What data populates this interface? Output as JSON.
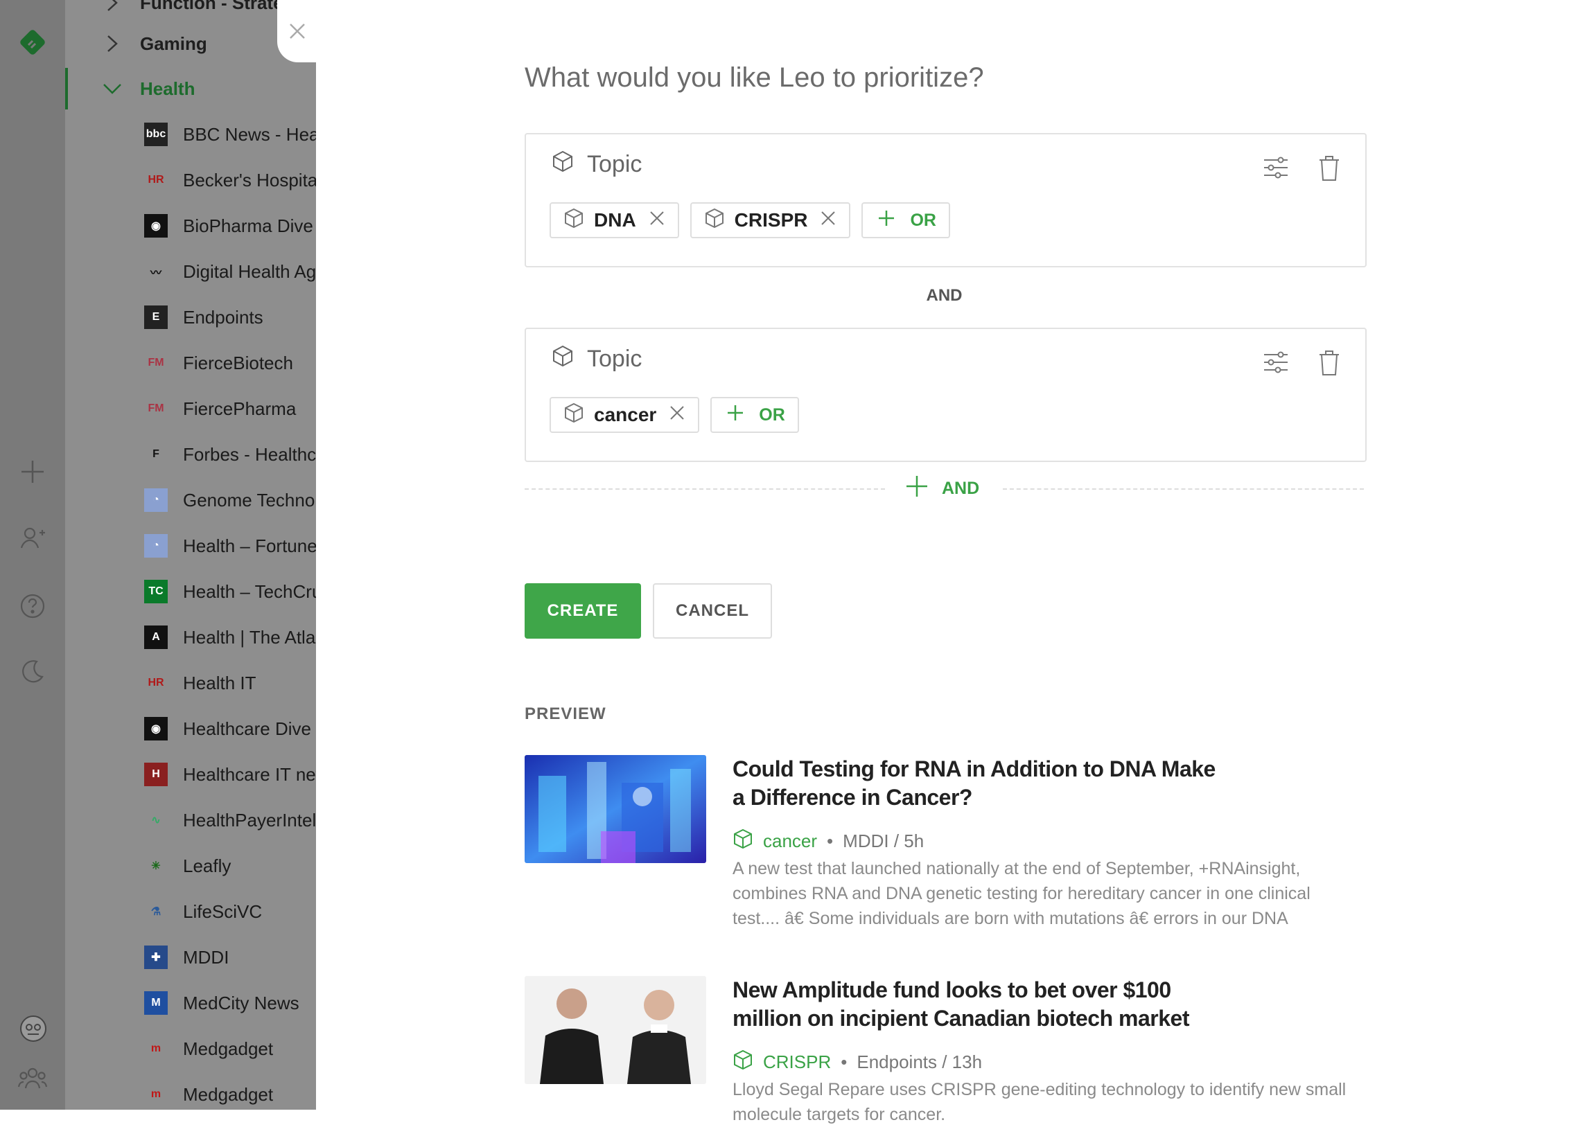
{
  "sidebar": {
    "categories": [
      {
        "label": "Function - Strategy"
      },
      {
        "label": "Gaming"
      },
      {
        "label": "Health"
      }
    ],
    "feeds": [
      {
        "label": "BBC News - Health",
        "icon": "bbc"
      },
      {
        "label": "Becker's Hospital Review",
        "icon": "HR"
      },
      {
        "label": "BioPharma Dive",
        "icon": "dive"
      },
      {
        "label": "Digital Health Age",
        "icon": "wifi"
      },
      {
        "label": "Endpoints",
        "icon": "E"
      },
      {
        "label": "FierceBiotech",
        "icon": "FM"
      },
      {
        "label": "FiercePharma",
        "icon": "FM"
      },
      {
        "label": "Forbes - Healthcare",
        "icon": "F"
      },
      {
        "label": "Genome Technology",
        "icon": "rss"
      },
      {
        "label": "Health – Fortune",
        "icon": "rss"
      },
      {
        "label": "Health – TechCrunch",
        "icon": "TC"
      },
      {
        "label": "Health | The Atlantic",
        "icon": "A"
      },
      {
        "label": "Health IT",
        "icon": "HR"
      },
      {
        "label": "Healthcare Dive",
        "icon": "dive"
      },
      {
        "label": "Healthcare IT news",
        "icon": "H"
      },
      {
        "label": "HealthPayerIntelligence",
        "icon": "pulse"
      },
      {
        "label": "Leafly",
        "icon": "leaf"
      },
      {
        "label": "LifeSciVC",
        "icon": "flask"
      },
      {
        "label": "MDDI",
        "icon": "grid"
      },
      {
        "label": "MedCity News",
        "icon": "M"
      },
      {
        "label": "Medgadget",
        "icon": "m"
      },
      {
        "label": "Medgadget",
        "icon": "m"
      }
    ]
  },
  "modal": {
    "question": "What would you like Leo to prioritize?",
    "groups": [
      {
        "header": "Topic",
        "chips": [
          "DNA",
          "CRISPR"
        ],
        "or_label": "OR"
      },
      {
        "header": "Topic",
        "chips": [
          "cancer"
        ],
        "or_label": "OR"
      }
    ],
    "and_label": "AND",
    "add_and_label": "AND",
    "create_label": "CREATE",
    "cancel_label": "CANCEL",
    "preview_label": "PREVIEW",
    "articles": [
      {
        "title": "Could Testing for RNA in Addition to DNA Make a Difference in Cancer?",
        "topic": "cancer",
        "source": "MDDI / 5h",
        "summary": "A new test that launched nationally at the end of September, +RNAinsight, combines RNA and DNA genetic testing for hereditary cancer in one clinical test.... â€  Some individuals are born with mutations â€  errors in our DNA"
      },
      {
        "title": "New Amplitude fund looks to bet over $100 million on incipient Canadian biotech market",
        "topic": "CRISPR",
        "source": "Endpoints / 13h",
        "summary": "Lloyd Segal Repare uses CRISPR gene-editing technology to identify new small molecule targets for cancer."
      }
    ]
  },
  "colors": {
    "accent": "#3fa649",
    "overlay": "#8e8e8e"
  }
}
